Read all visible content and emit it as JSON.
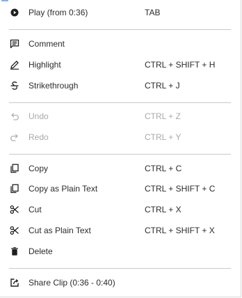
{
  "menu": {
    "items": {
      "play": {
        "label": "Play (from 0:36)",
        "shortcut": "TAB",
        "icon": "play-circle-icon",
        "enabled": true
      },
      "comment": {
        "label": "Comment",
        "shortcut": "",
        "icon": "comment-icon",
        "enabled": true
      },
      "highlight": {
        "label": "Highlight",
        "shortcut": "CTRL + SHIFT + H",
        "icon": "pencil-icon",
        "enabled": true
      },
      "strikethrough": {
        "label": "Strikethrough",
        "shortcut": "CTRL + J",
        "icon": "strikethrough-icon",
        "enabled": true
      },
      "undo": {
        "label": "Undo",
        "shortcut": "CTRL + Z",
        "icon": "undo-icon",
        "enabled": false
      },
      "redo": {
        "label": "Redo",
        "shortcut": "CTRL + Y",
        "icon": "redo-icon",
        "enabled": false
      },
      "copy": {
        "label": "Copy",
        "shortcut": "CTRL + C",
        "icon": "copy-icon",
        "enabled": true
      },
      "copy_plain": {
        "label": "Copy as Plain Text",
        "shortcut": "CTRL + SHIFT + C",
        "icon": "copy-icon",
        "enabled": true
      },
      "cut": {
        "label": "Cut",
        "shortcut": "CTRL + X",
        "icon": "scissors-icon",
        "enabled": true
      },
      "cut_plain": {
        "label": "Cut as Plain Text",
        "shortcut": "CTRL + SHIFT + X",
        "icon": "scissors-icon",
        "enabled": true
      },
      "delete": {
        "label": "Delete",
        "shortcut": "",
        "icon": "trash-icon",
        "enabled": true
      },
      "share": {
        "label": "Share Clip (0:36 - 0:40)",
        "shortcut": "",
        "icon": "share-icon",
        "enabled": true
      }
    }
  },
  "colors": {
    "text": "#2b2b2b",
    "disabled_text": "#a9a9a9",
    "icon": "#1f1f1f",
    "disabled_icon": "#b0b0b0",
    "divider": "#c8c8c8"
  }
}
